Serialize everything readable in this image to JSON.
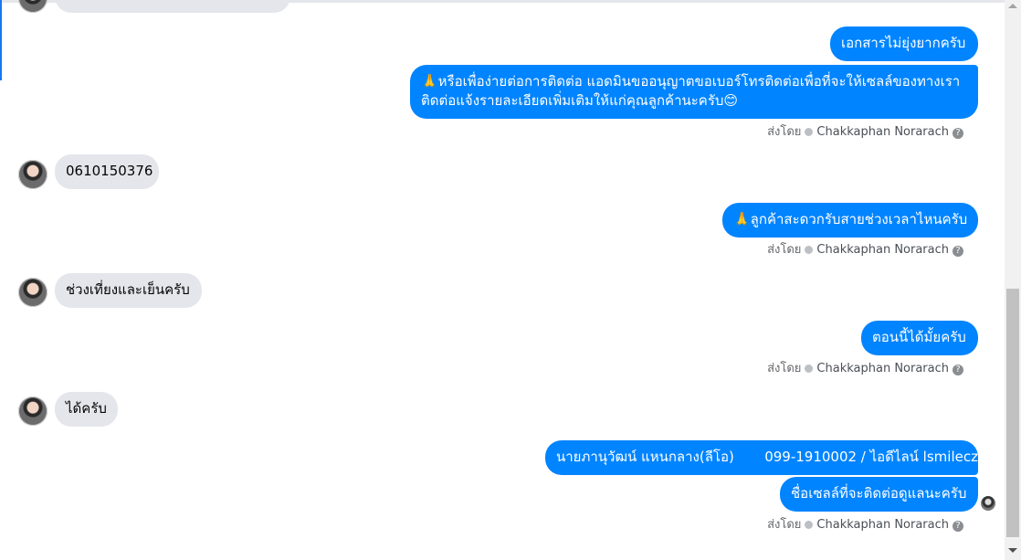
{
  "chat": {
    "meta_prefix": "ส่งโดย",
    "agent_name": "Chakkaphan Norarach",
    "help_glyph": "?",
    "messages": {
      "m1": "เอกสารไม่ยุ่งยากครับ",
      "m2": "🙏หรือเพื่อง่ายต่อการติดต่อ แอดมินขออนุญาตขอเบอร์โทรติดต่อเพื่อที่จะให้เซลล์ของทางเราติดต่อแจ้งรายละเอียดเพิ่มเติมให้แก่คุณลูกค้านะครับ😊",
      "m3": "0610150376",
      "m4": "🙏ลูกค้าสะดวกรับสายช่วงเวลาไหนครับ",
      "m5": "ช่วงเที่ยงและเย็นครับ",
      "m6": "ตอนนี้ได้มั้ยครับ",
      "m7": "ได้ครับ",
      "m8": "นายภานุวัฒน์ แหนกลาง(ลีโอ)       099-1910002 / ไอดีไลน์ lsmilecz",
      "m9": "ชื่อเซลล์ที่จะติดต่อดูแลนะครับ"
    }
  },
  "colors": {
    "outgoing": "#0084ff",
    "incoming": "#e4e6eb",
    "accent": "#1877f2"
  }
}
